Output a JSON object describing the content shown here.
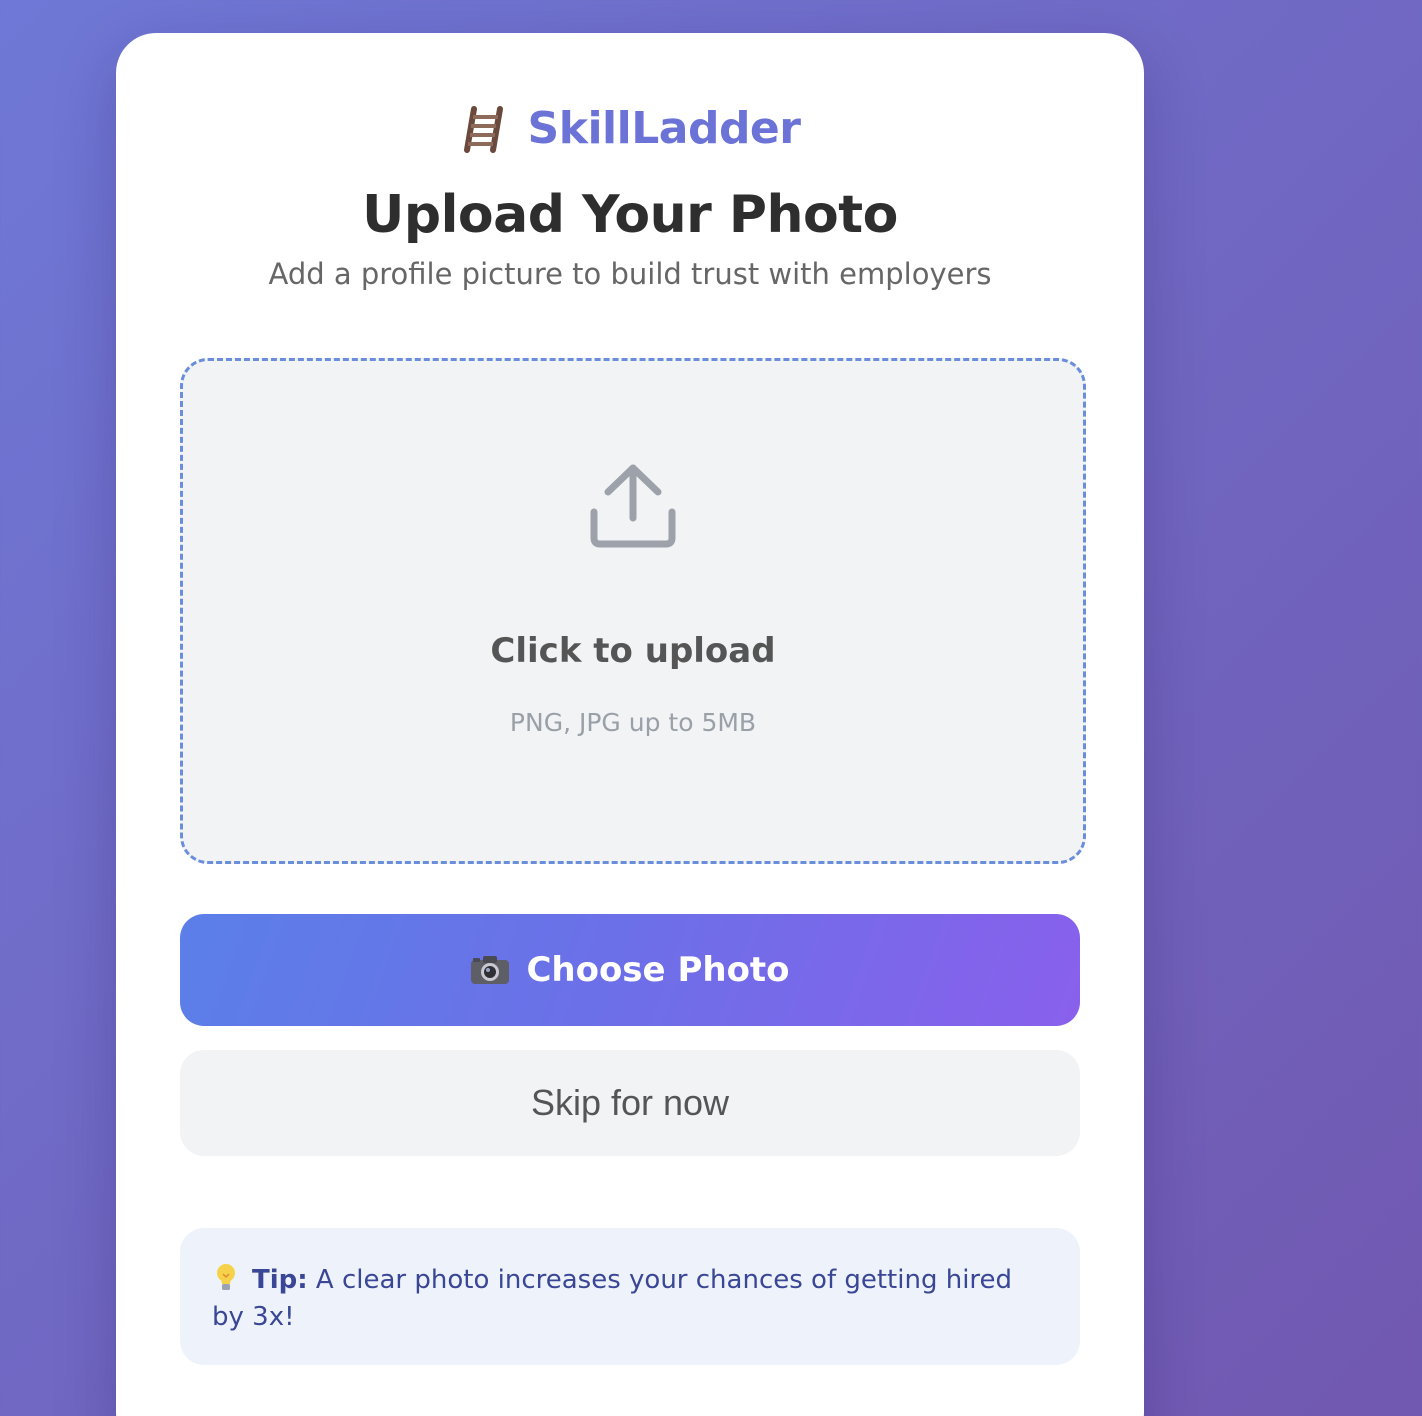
{
  "brand": {
    "name": "SkillLadder",
    "icon": "ladder-icon",
    "color": "#6b73d7"
  },
  "page": {
    "title": "Upload Your Photo",
    "subtitle": "Add a profile picture to build trust with employers"
  },
  "dropzone": {
    "icon": "upload-icon",
    "title": "Click to upload",
    "hint": "PNG, JPG up to 5MB"
  },
  "buttons": {
    "choose_icon": "camera-icon",
    "choose_label": "Choose Photo",
    "skip_label": "Skip for now"
  },
  "tip": {
    "icon": "lightbulb-icon",
    "label": "Tip:",
    "text": "A clear photo increases your chances of getting hired by 3x!"
  },
  "colors": {
    "background_start": "#6f78d6",
    "background_end": "#7158b0",
    "button_gradient_start": "#5b7fe8",
    "button_gradient_end": "#8960ec",
    "dropzone_border": "#6a8edc",
    "tip_text": "#3a4796"
  }
}
